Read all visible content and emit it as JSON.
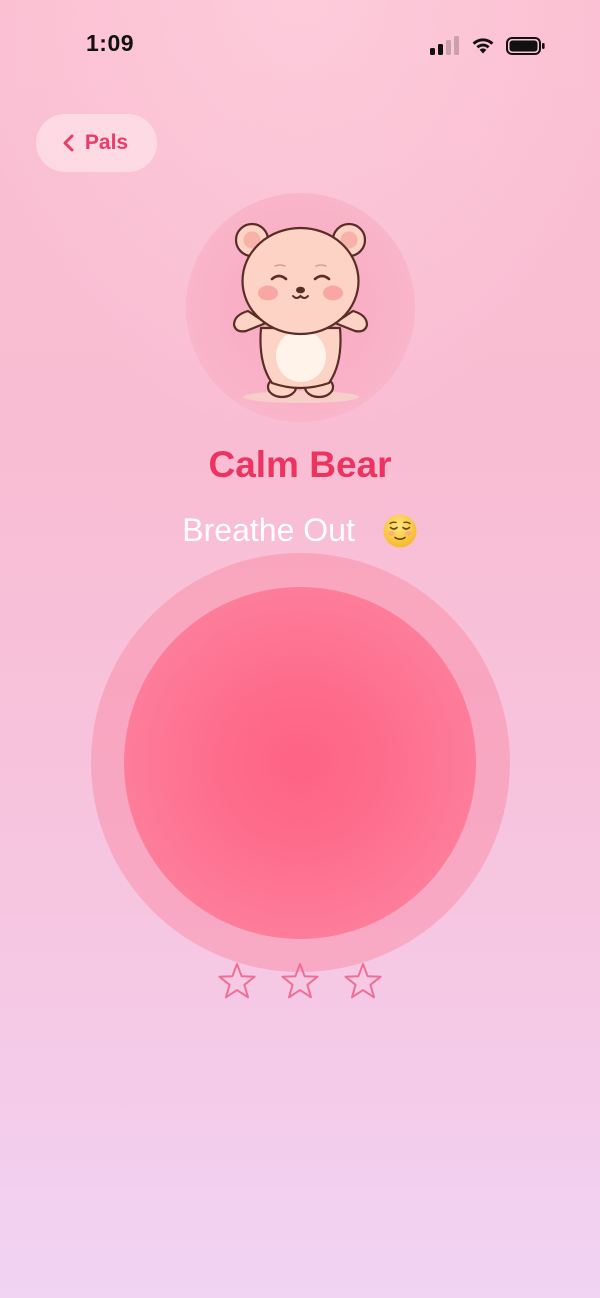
{
  "status_bar": {
    "time": "1:09",
    "signal_icon": "cellular-signal-icon",
    "wifi_icon": "wifi-icon",
    "battery_icon": "battery-icon"
  },
  "nav": {
    "back_label": "Pals",
    "back_icon": "chevron-left-icon"
  },
  "pal": {
    "name": "Calm Bear",
    "avatar": "bear-avatar-illustration"
  },
  "breathing": {
    "phase_label": "Breathe Out",
    "phase_emoji": "relieved-face-emoji"
  },
  "stars": {
    "total": 3,
    "filled": 0,
    "icon": "star-outline-icon"
  },
  "colors": {
    "accent": "#ed3461",
    "back_text": "#ea3c68",
    "circle_core": "#fd6385",
    "star_outline": "#ee6f93",
    "background_top": "#fbbfd2",
    "background_bottom": "#f1d3f3"
  }
}
